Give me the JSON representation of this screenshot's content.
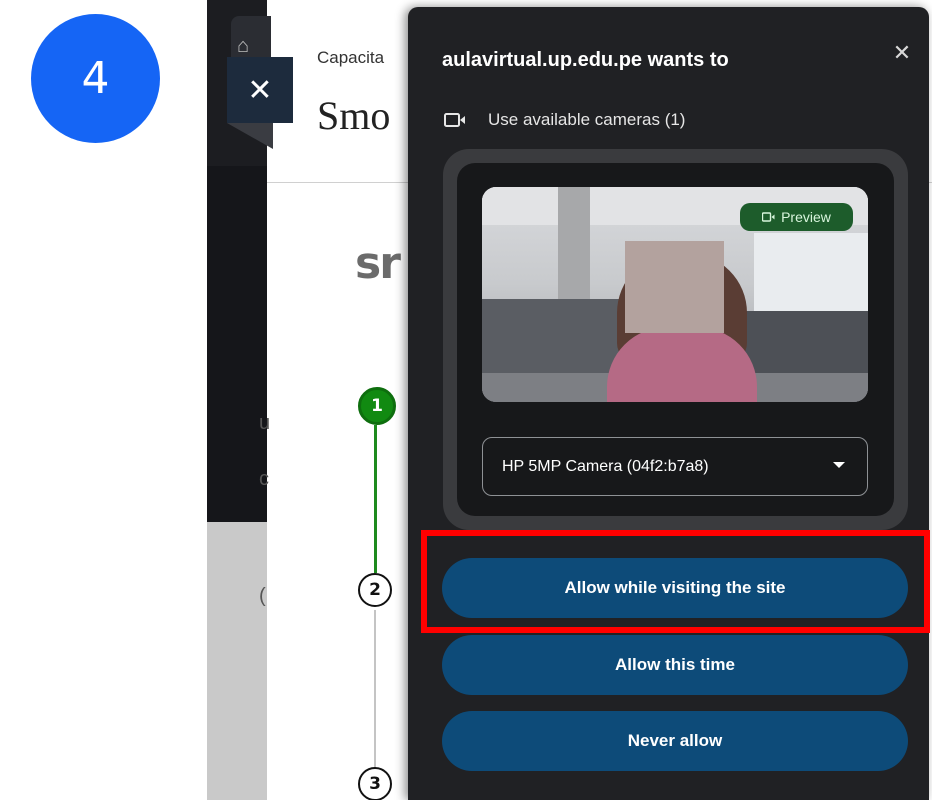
{
  "step_badge": {
    "number": "4"
  },
  "background_page": {
    "breadcrumb": "Capacita",
    "title": "Smo",
    "logo_partial": "sr",
    "side_letters": [
      "u",
      "c",
      "("
    ],
    "stepper": [
      "1",
      "2",
      "3"
    ]
  },
  "permission_popup": {
    "title": "aulavirtual.up.edu.pe wants to",
    "close_glyph": "✕",
    "camera_request": {
      "icon": "video-camera-icon",
      "label": "Use available cameras (1)"
    },
    "preview_badge": "Preview",
    "camera_select": {
      "selected": "HP 5MP Camera (04f2:b7a8)"
    },
    "buttons": {
      "allow_site": "Allow while visiting the site",
      "allow_once": "Allow this time",
      "never": "Never allow"
    }
  },
  "colors": {
    "badge_blue": "#1565f5",
    "popup_bg": "#202124",
    "button_bg": "#0d4b79",
    "highlight": "#ff0000",
    "step_green": "#118a11"
  }
}
